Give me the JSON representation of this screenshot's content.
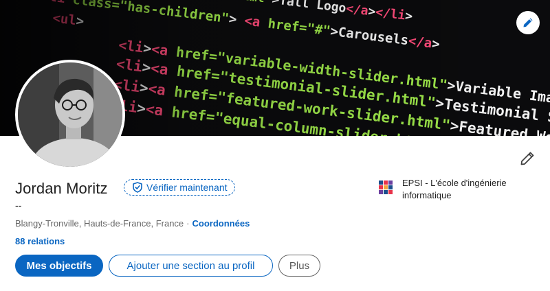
{
  "banner": {
    "code_lines": [
      "<li><a href=\"tall-logo.html\">Tall Logo</a></li>",
      "<li class=\"has-children\"> <a href=\"#\">Carousels</a>",
      "<ul>",
      "<li><a href=\"variable-width-slider.html\">Variable Image W",
      "<li><a href=\"testimonial-slider.html\">Testimonial Slider</a>",
      "<li><a href=\"featured-work-slider.html\">Featured Work Slid",
      "<li><a href=\"equal-column-slider.html\">Equal Col"
    ]
  },
  "profile": {
    "name": "Jordan Moritz",
    "verify_label": "Vérifier maintenant",
    "headline": "--",
    "location": "Blangy-Tronville, Hauts-de-France, France",
    "separator": "·",
    "contact_label": "Coordonnées",
    "relations": "88 relations"
  },
  "actions": {
    "primary": "Mes objectifs",
    "add_section": "Ajouter une section au profil",
    "more": "Plus"
  },
  "school": {
    "name": "EPSI - L'école d'ingénierie informatique"
  },
  "colors": {
    "accent": "#0a66c2",
    "banner_bg": "#0b0b0d",
    "code_green": "#9ee84a",
    "code_red": "#ff4b7a",
    "code_white": "#f5f5f5"
  },
  "icons": {
    "banner_edit": "pencil-icon",
    "profile_edit": "pencil-icon",
    "verify": "shield-check-icon"
  }
}
